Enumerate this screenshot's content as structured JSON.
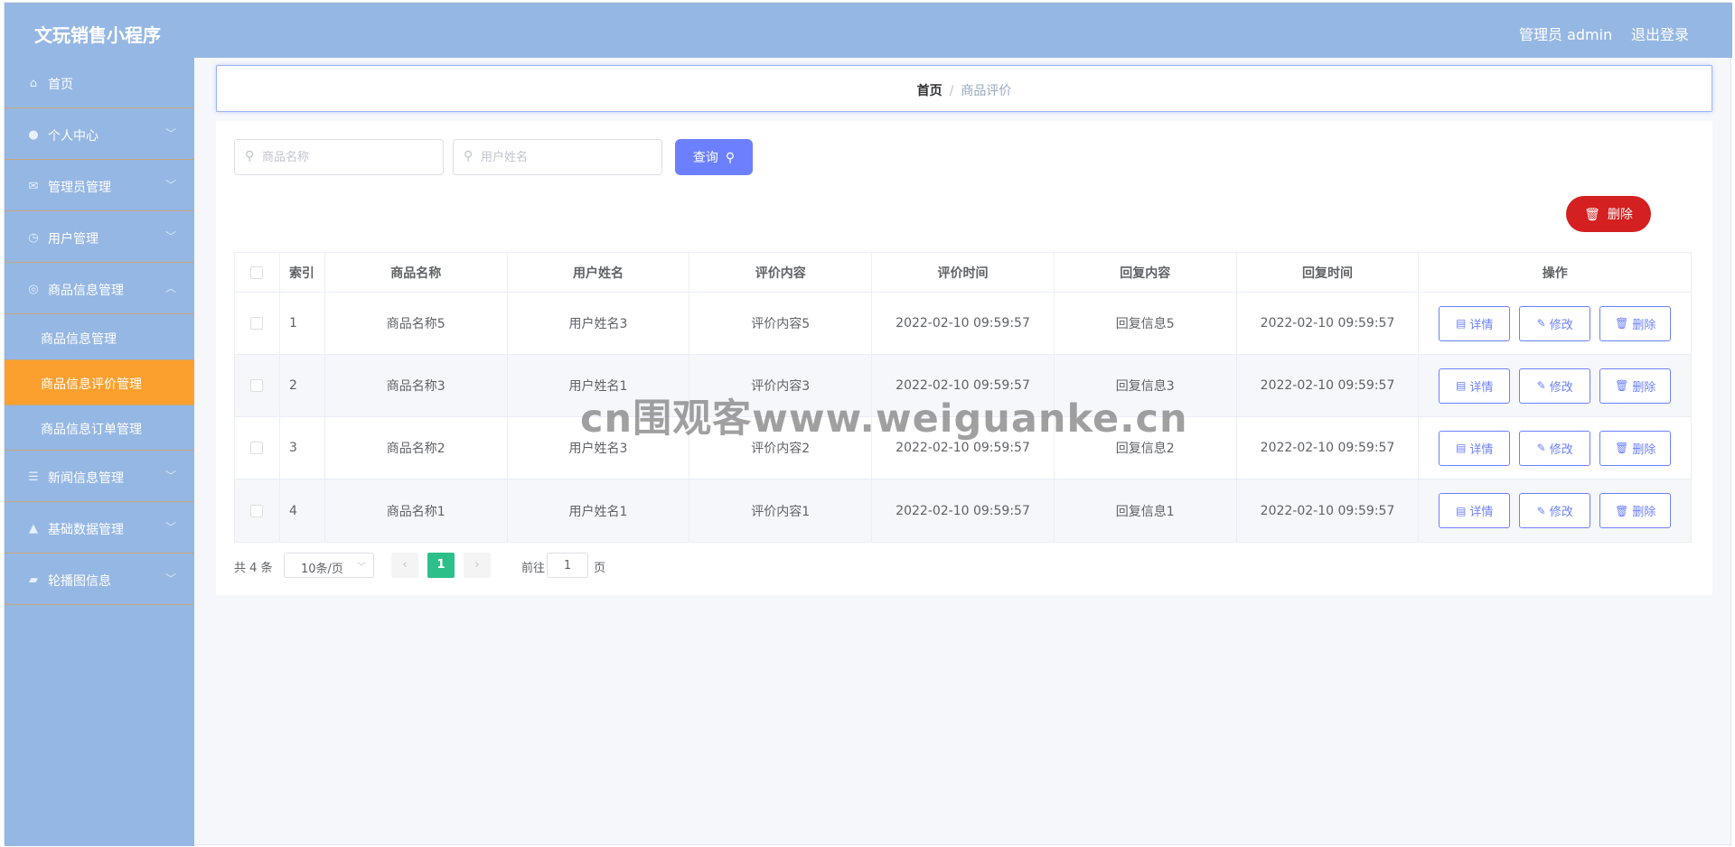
{
  "header": {
    "app_title": "文玩销售小程序",
    "user_label": "管理员 admin",
    "logout_label": "退出登录"
  },
  "sidebar": {
    "items": [
      {
        "label": "首页",
        "icon": "home-icon"
      },
      {
        "label": "个人中心",
        "icon": "user-icon"
      },
      {
        "label": "管理员管理",
        "icon": "mail-icon"
      },
      {
        "label": "用户管理",
        "icon": "clock-icon"
      },
      {
        "label": "商品信息管理",
        "icon": "target-icon"
      },
      {
        "label": "新闻信息管理",
        "icon": "list-icon"
      },
      {
        "label": "基础数据管理",
        "icon": "person-icon"
      },
      {
        "label": "轮播图信息",
        "icon": "image-icon"
      }
    ],
    "subitems": [
      {
        "label": "商品信息管理"
      },
      {
        "label": "商品信息评价管理"
      },
      {
        "label": "商品信息订单管理"
      }
    ],
    "active_color": "#fba02e",
    "background_color": "#95b7e3"
  },
  "breadcrumb": {
    "home": "首页",
    "separator": "/",
    "current": "商品评价"
  },
  "search": {
    "product_placeholder": "商品名称",
    "user_placeholder": "用户姓名",
    "query_label": "查询"
  },
  "toolbar": {
    "delete_label": "删除"
  },
  "table": {
    "headers": [
      "索引",
      "商品名称",
      "用户姓名",
      "评价内容",
      "评价时间",
      "回复内容",
      "回复时间",
      "操作"
    ],
    "rows": [
      {
        "index": "1",
        "product": "商品名称5",
        "user": "用户姓名3",
        "content": "评价内容5",
        "time": "2022-02-10 09:59:57",
        "reply": "回复信息5",
        "reply_time": "2022-02-10 09:59:57"
      },
      {
        "index": "2",
        "product": "商品名称3",
        "user": "用户姓名1",
        "content": "评价内容3",
        "time": "2022-02-10 09:59:57",
        "reply": "回复信息3",
        "reply_time": "2022-02-10 09:59:57"
      },
      {
        "index": "3",
        "product": "商品名称2",
        "user": "用户姓名3",
        "content": "评价内容2",
        "time": "2022-02-10 09:59:57",
        "reply": "回复信息2",
        "reply_time": "2022-02-10 09:59:57"
      },
      {
        "index": "4",
        "product": "商品名称1",
        "user": "用户姓名1",
        "content": "评价内容1",
        "time": "2022-02-10 09:59:57",
        "reply": "回复信息1",
        "reply_time": "2022-02-10 09:59:57"
      }
    ],
    "ops": {
      "detail": "详情",
      "edit": "修改",
      "delete": "删除"
    }
  },
  "pagination": {
    "total": "共 4 条",
    "page_size": "10条/页",
    "current_page": "1",
    "goto_prefix": "前往",
    "goto_value": "1",
    "goto_suffix": "页"
  },
  "watermark": "cn围观客www.weiguanke.cn",
  "colors": {
    "primary": "#6c80ff",
    "danger": "#d42020",
    "success": "#2dbf8a"
  }
}
